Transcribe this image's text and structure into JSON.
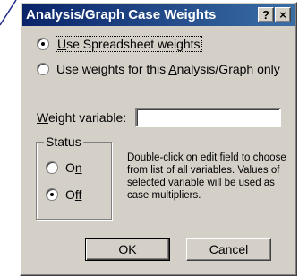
{
  "window": {
    "title": "Analysis/Graph Case Weights",
    "help_button": "?",
    "close_button": "×"
  },
  "options": {
    "spreadsheet_weights": {
      "pre": "",
      "accel": "U",
      "post": "se Spreadsheet weights",
      "selected": true
    },
    "analysis_weights": {
      "pre": "Use weights for this ",
      "accel": "A",
      "post": "nalysis/Graph only",
      "selected": false
    }
  },
  "weight_variable": {
    "label_accel": "W",
    "label_rest": "eight variable:",
    "value": ""
  },
  "status": {
    "title": "Status",
    "on": {
      "pre": "O",
      "accel": "n",
      "post": "",
      "selected": false
    },
    "off": {
      "pre": "O",
      "accel": "ff",
      "post": "",
      "selected": true
    }
  },
  "help_text": "Double-click on edit field to choose from list of all variables. Values of selected variable will be used as case multipliers.",
  "buttons": {
    "ok": "OK",
    "cancel": "Cancel"
  }
}
